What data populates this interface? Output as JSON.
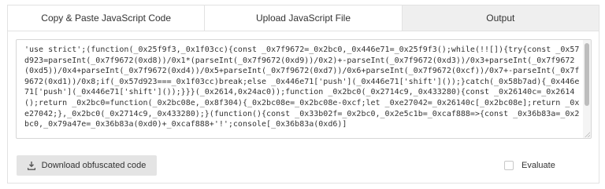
{
  "tabs": [
    {
      "label": "Copy & Paste JavaScript Code",
      "active": false
    },
    {
      "label": "Upload JavaScript File",
      "active": false
    },
    {
      "label": "Output",
      "active": true
    }
  ],
  "output": {
    "code": "'use strict';(function(_0x25f9f3,_0x1f03cc){const _0x7f9672=_0x2bc0,_0x446e71=_0x25f9f3();while(!![]){try{const _0x57d923=parseInt(_0x7f9672(0xd8))/0x1*(parseInt(_0x7f9672(0xd9))/0x2)+-parseInt(_0x7f9672(0xd3))/0x3+parseInt(_0x7f9672(0xd5))/0x4+parseInt(_0x7f9672(0xd4))/0x5+parseInt(_0x7f9672(0xd7))/0x6+parseInt(_0x7f9672(0xcf))/0x7+-parseInt(_0x7f9672(0xd1))/0x8;if(_0x57d923===_0x1f03cc)break;else _0x446e71['push'](_0x446e71['shift']());}catch(_0x58b7ad){_0x446e71['push'](_0x446e71['shift']());}}}(_0x2614,0x24ac0));function _0x2bc0(_0x2714c9,_0x433280){const _0x26140c=_0x2614();return _0x2bc0=function(_0x2bc08e,_0x8f304){_0x2bc08e=_0x2bc08e-0xcf;let _0xe27042=_0x26140c[_0x2bc08e];return _0xe27042;},_0x2bc0(_0x2714c9,_0x433280);}(function(){const _0x33b02f=_0x2bc0,_0x2e5c1b=_0xcaf888=>{const _0x36b83a=_0x2bc0,_0x79a47e=_0x36b83a(0xd0)+_0xcaf888+'!';console[_0x36b83a(0xd6)]"
  },
  "actions": {
    "download_label": "Download obfuscated code",
    "download_icon": "download-icon",
    "evaluate_label": "Evaluate",
    "evaluate_checked": false
  },
  "colors": {
    "active_tab_bg": "#efefef",
    "button_bg": "#e4e4e4",
    "border": "#e2e2e2"
  }
}
